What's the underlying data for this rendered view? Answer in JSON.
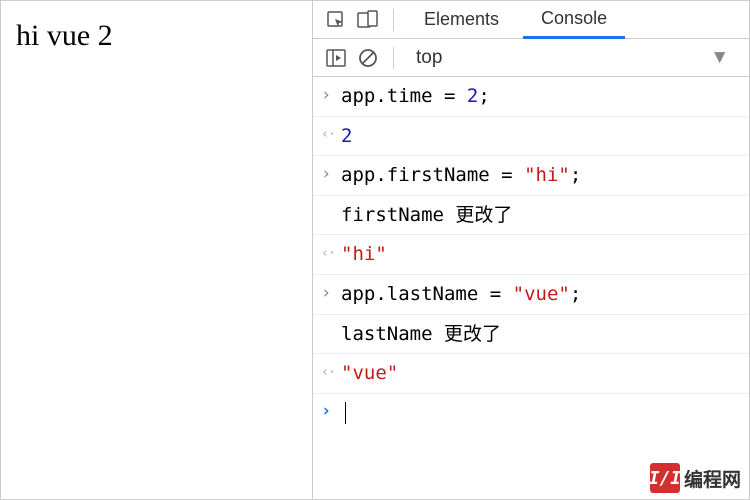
{
  "page": {
    "content": "hi vue 2"
  },
  "devtools": {
    "tabs": {
      "elements": "Elements",
      "console": "Console"
    },
    "toolbar": {
      "context": "top"
    },
    "console": {
      "entries": [
        {
          "kind": "in",
          "segments": [
            {
              "t": "obj",
              "v": "app"
            },
            {
              "t": "punct",
              "v": "."
            },
            {
              "t": "obj",
              "v": "time"
            },
            {
              "t": "punct",
              "v": " = "
            },
            {
              "t": "num",
              "v": "2"
            },
            {
              "t": "punct",
              "v": ";"
            }
          ]
        },
        {
          "kind": "out",
          "segments": [
            {
              "t": "num",
              "v": "2"
            }
          ]
        },
        {
          "kind": "in",
          "segments": [
            {
              "t": "obj",
              "v": "app"
            },
            {
              "t": "punct",
              "v": "."
            },
            {
              "t": "obj",
              "v": "firstName"
            },
            {
              "t": "punct",
              "v": " = "
            },
            {
              "t": "str",
              "v": "\"hi\""
            },
            {
              "t": "punct",
              "v": ";"
            }
          ]
        },
        {
          "kind": "log",
          "segments": [
            {
              "t": "obj",
              "v": "firstName 更改了"
            }
          ]
        },
        {
          "kind": "out",
          "segments": [
            {
              "t": "str",
              "v": "\"hi\""
            }
          ]
        },
        {
          "kind": "in",
          "segments": [
            {
              "t": "obj",
              "v": "app"
            },
            {
              "t": "punct",
              "v": "."
            },
            {
              "t": "obj",
              "v": "lastName"
            },
            {
              "t": "punct",
              "v": " = "
            },
            {
              "t": "str",
              "v": "\"vue\""
            },
            {
              "t": "punct",
              "v": ";"
            }
          ]
        },
        {
          "kind": "log",
          "segments": [
            {
              "t": "obj",
              "v": "lastName 更改了"
            }
          ]
        },
        {
          "kind": "out",
          "segments": [
            {
              "t": "str",
              "v": "\"vue\""
            }
          ]
        }
      ]
    }
  },
  "watermark": {
    "logo_text": "I/I",
    "text": "编程网"
  }
}
